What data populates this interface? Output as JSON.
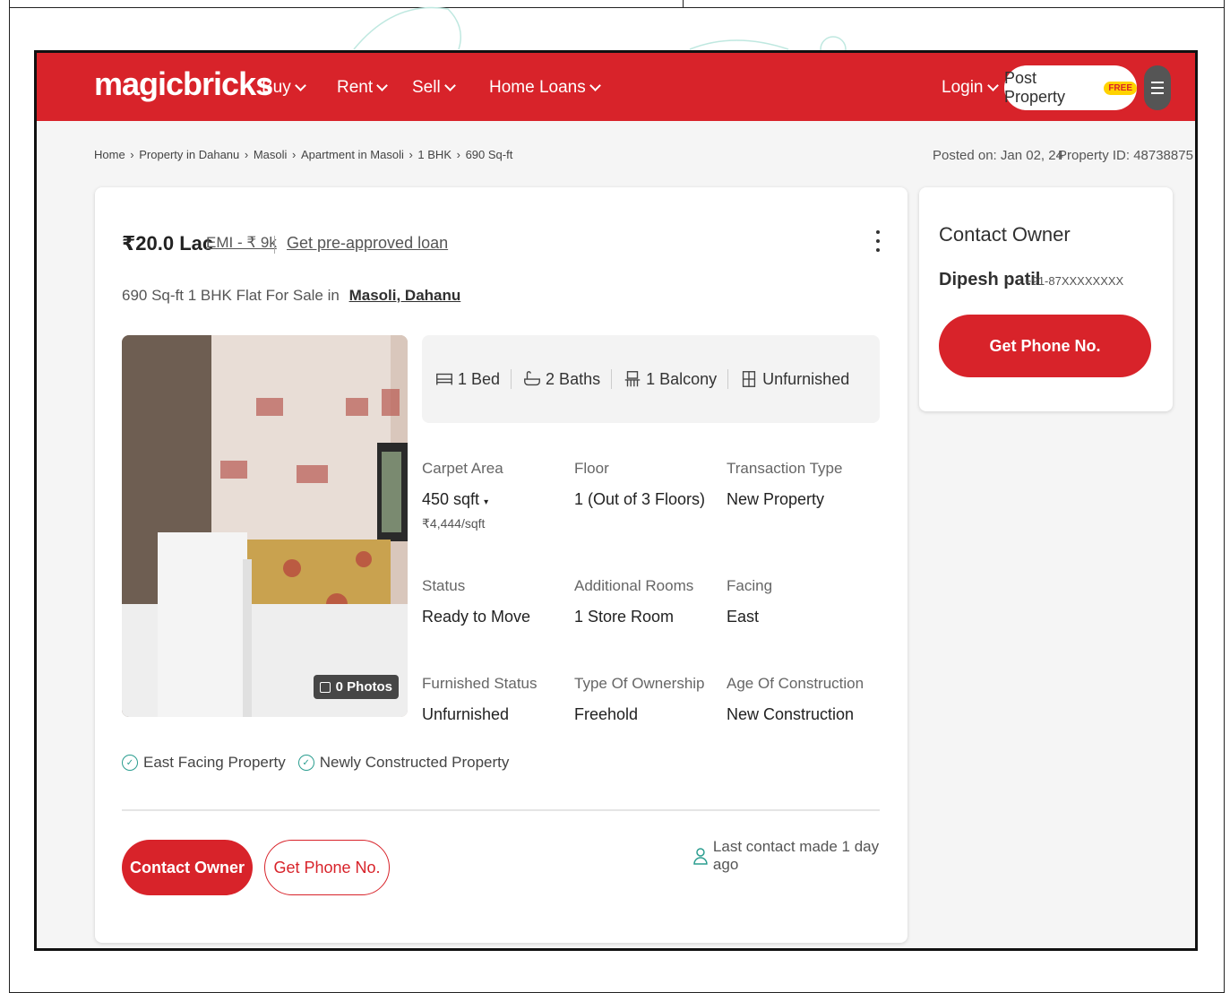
{
  "nav": {
    "logo": "magicbricks",
    "items": [
      "Buy",
      "Rent",
      "Sell",
      "Home Loans"
    ],
    "login": "Login",
    "post_property": "Post Property",
    "free_badge": "FREE",
    "brand_color": "#d8232a"
  },
  "breadcrumb": [
    "Home",
    "Property in Dahanu",
    "Masoli",
    "Apartment in Masoli",
    "1 BHK",
    "690 Sq-ft"
  ],
  "meta": {
    "posted_on": "Posted on: Jan 02, 24",
    "property_id": "Property ID: 48738875"
  },
  "listing": {
    "price": "₹20.0 Lac",
    "emi": "EMI - ₹ 9k",
    "preapproved": "Get pre-approved loan",
    "subtitle": "690 Sq-ft 1 BHK Flat For Sale in",
    "location": "Masoli, Dahanu",
    "photos": "0 Photos",
    "amenities": [
      {
        "label": "1 Bed",
        "icon": "bed-icon"
      },
      {
        "label": "2 Baths",
        "icon": "bath-icon"
      },
      {
        "label": "1 Balcony",
        "icon": "balcony-icon"
      },
      {
        "label": "Unfurnished",
        "icon": "furnishing-icon"
      }
    ],
    "details": {
      "carpet_area": {
        "label": "Carpet Area",
        "value": "450 sqft",
        "sub": "₹4,444/sqft"
      },
      "floor": {
        "label": "Floor",
        "value": "1 (Out of 3 Floors)"
      },
      "transaction": {
        "label": "Transaction Type",
        "value": "New Property"
      },
      "status": {
        "label": "Status",
        "value": "Ready to Move"
      },
      "rooms": {
        "label": "Additional Rooms",
        "value": "1 Store Room"
      },
      "facing": {
        "label": "Facing",
        "value": "East"
      },
      "furnished": {
        "label": "Furnished Status",
        "value": "Unfurnished"
      },
      "ownership": {
        "label": "Type Of Ownership",
        "value": "Freehold"
      },
      "age": {
        "label": "Age Of Construction",
        "value": "New Construction"
      }
    },
    "tags": [
      "East Facing Property",
      "Newly Constructed Property"
    ],
    "contact_owner": "Contact Owner",
    "get_phone": "Get Phone No.",
    "last_contact": "Last contact made 1 day ago"
  },
  "side": {
    "title": "Contact Owner",
    "owner_name": "Dipesh patil",
    "owner_phone": "+91-87XXXXXXXX",
    "get_phone": "Get Phone No."
  }
}
